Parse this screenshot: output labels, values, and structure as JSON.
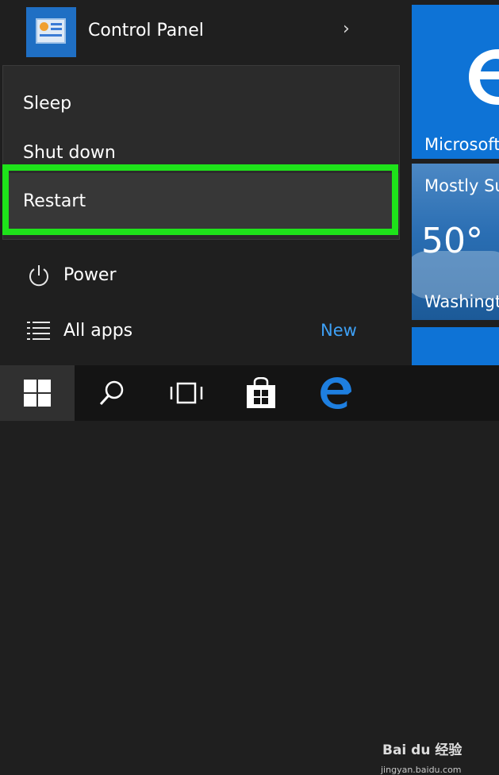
{
  "start_menu": {
    "control_panel_label": "Control Panel",
    "power_menu": {
      "sleep": "Sleep",
      "shut_down": "Shut down",
      "restart": "Restart"
    },
    "power_label": "Power",
    "all_apps_label": "All apps",
    "new_badge": "New"
  },
  "tiles": {
    "edge_label": "Microsoft Edge",
    "weather_condition": "Mostly Sunny",
    "weather_temp": "50°",
    "weather_location": "Washington"
  },
  "taskbar": {
    "icons": [
      "windows-logo-icon",
      "search-icon",
      "task-view-icon",
      "store-icon",
      "edge-icon"
    ]
  },
  "watermark": {
    "brand": "Bai du 经验",
    "url": "jingyan.baidu.com"
  },
  "colors": {
    "highlight": "#1ee31a",
    "accent_blue": "#0e73d6",
    "new_badge": "#3ea0f5"
  }
}
